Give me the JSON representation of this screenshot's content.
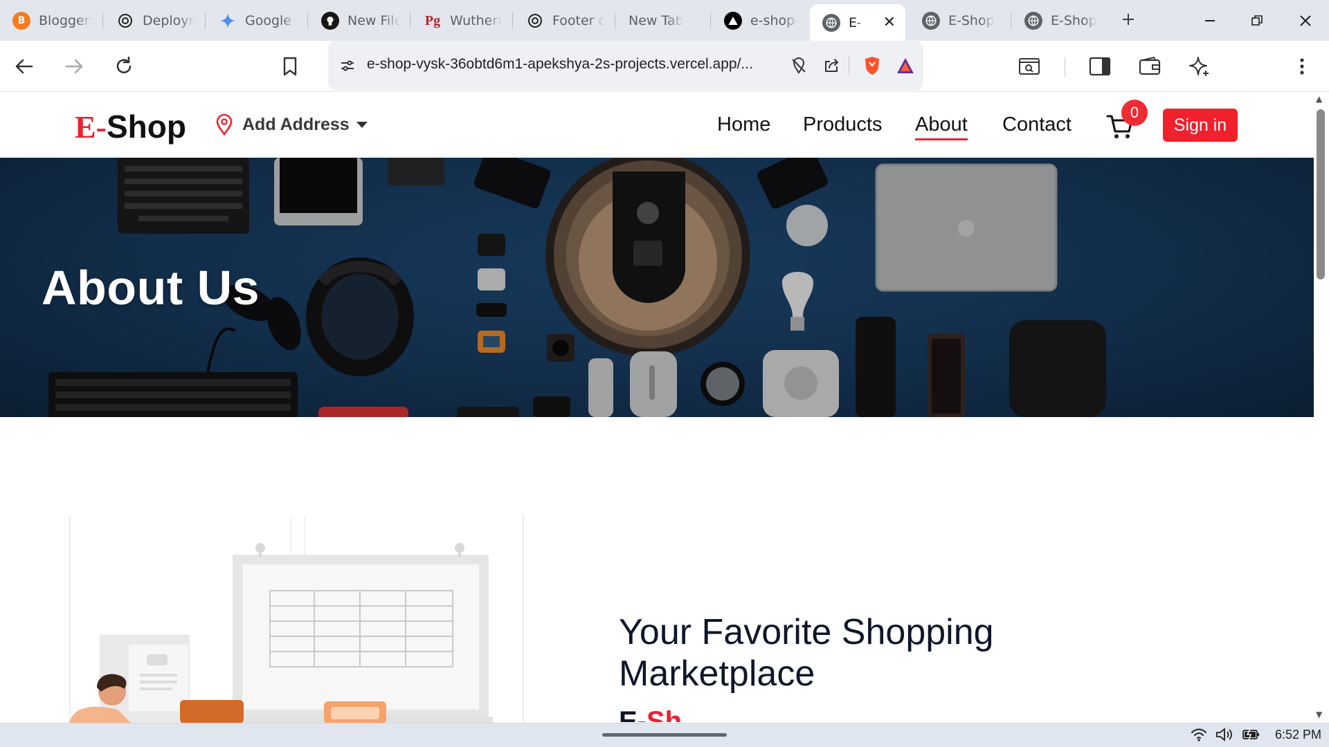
{
  "browser": {
    "tabs": [
      {
        "title": "Blogger:",
        "icon": "blogger-icon",
        "color": "#f57c20"
      },
      {
        "title": "Deploym",
        "icon": "openai-icon",
        "color": "#222222"
      },
      {
        "title": "Google C",
        "icon": "gemini-icon",
        "color": "#4c8df6"
      },
      {
        "title": "New File",
        "icon": "github-icon",
        "color": "#181717"
      },
      {
        "title": "Wutherin",
        "icon": "pg-icon",
        "color": "#b3282d"
      },
      {
        "title": "Footer cc",
        "icon": "openai-icon",
        "color": "#222222"
      },
      {
        "title": "New Tab",
        "icon": "",
        "color": ""
      },
      {
        "title": "e-shop-v",
        "icon": "vercel-icon",
        "color": "#000000"
      },
      {
        "title": "E-",
        "icon": "globe-icon",
        "color": "#5f6368",
        "active": true
      },
      {
        "title": "E-Shop",
        "icon": "globe-icon",
        "color": "#5f6368"
      },
      {
        "title": "E-Shop",
        "icon": "globe-icon",
        "color": "#5f6368"
      }
    ],
    "url": "e-shop-vysk-36obtd6m1-apekshya-2s-projects.vercel.app/..."
  },
  "site": {
    "logo_e": "E-",
    "logo_rest": "Shop",
    "address_label": "Add Address",
    "nav": {
      "home": "Home",
      "products": "Products",
      "about": "About",
      "contact": "Contact"
    },
    "cart_count": "0",
    "signin_label": "Sign in",
    "accent": "#e8232f"
  },
  "hero": {
    "title": "About Us"
  },
  "about": {
    "heading": "Your Favorite Shopping Marketplace",
    "brand_e": "E-",
    "brand_s": "Sh"
  },
  "taskbar": {
    "time": "6:52 PM"
  }
}
